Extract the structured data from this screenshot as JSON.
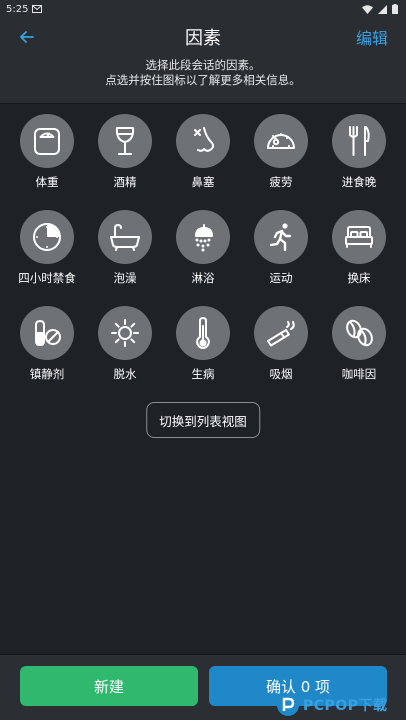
{
  "status": {
    "time": "5:25"
  },
  "header": {
    "title": "因素",
    "edit_label": "编辑",
    "subtitle_line1": "选择此段会话的因素。",
    "subtitle_line2": "点选并按住图标以了解更多相关信息。"
  },
  "factors": [
    [
      {
        "label": "体重",
        "icon": "scale-icon"
      },
      {
        "label": "酒精",
        "icon": "wine-glass-icon"
      },
      {
        "label": "鼻塞",
        "icon": "nose-icon"
      },
      {
        "label": "疲劳",
        "icon": "gauge-icon"
      },
      {
        "label": "进食晚",
        "icon": "fork-knife-icon"
      }
    ],
    [
      {
        "label": "四小时禁食",
        "icon": "clock-pie-icon"
      },
      {
        "label": "泡澡",
        "icon": "bathtub-icon"
      },
      {
        "label": "淋浴",
        "icon": "shower-icon"
      },
      {
        "label": "运动",
        "icon": "running-icon"
      },
      {
        "label": "换床",
        "icon": "bed-icon"
      }
    ],
    [
      {
        "label": "镇静剂",
        "icon": "pills-icon"
      },
      {
        "label": "脱水",
        "icon": "sun-icon"
      },
      {
        "label": "生病",
        "icon": "thermometer-icon"
      },
      {
        "label": "吸烟",
        "icon": "cigarette-icon"
      },
      {
        "label": "咖啡因",
        "icon": "coffee-bean-icon"
      }
    ]
  ],
  "switch_view_label": "切换到列表视图",
  "bottom": {
    "new_label": "新建",
    "confirm_label": "确认 0 项"
  },
  "watermark": {
    "text": "PCPOP下载"
  },
  "colors": {
    "accent": "#3aa0e0",
    "new_button": "#2fb86e",
    "confirm_button": "#1f88c9",
    "icon_circle": "#6e7277",
    "background": "#1e2227"
  }
}
